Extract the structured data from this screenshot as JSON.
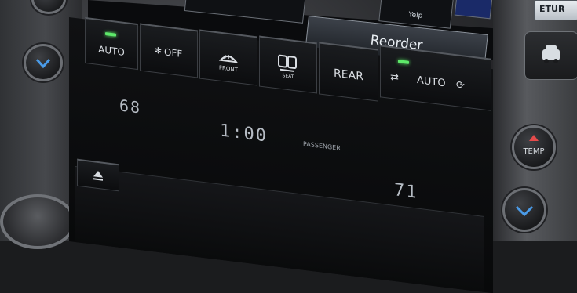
{
  "nav_screen": {
    "yelp_label": "Yelp",
    "reorder_label": "Reorder",
    "corner_label": "ETUR"
  },
  "climate": {
    "auto_label": "AUTO",
    "fan_off_label": "OFF",
    "front_label": "FRONT",
    "recirc_label": "SEAT",
    "rear_label": "REAR",
    "passenger_auto_label": "AUTO",
    "passenger_label": "PASSENGER",
    "driver_temp": "68",
    "clock": "1:00",
    "passenger_temp": "71",
    "temp_button_label": "TEMP",
    "led_color": "#5ee86a"
  },
  "icons": {
    "fan": "fan-icon",
    "defrost_front": "front-defrost-icon",
    "seat": "seat-climate-icon",
    "recirc_in": "recirculation-icon",
    "recirc_out": "fresh-air-icon",
    "eject": "eject-icon",
    "car": "car-icon",
    "chevron": "chevron-down-icon"
  }
}
